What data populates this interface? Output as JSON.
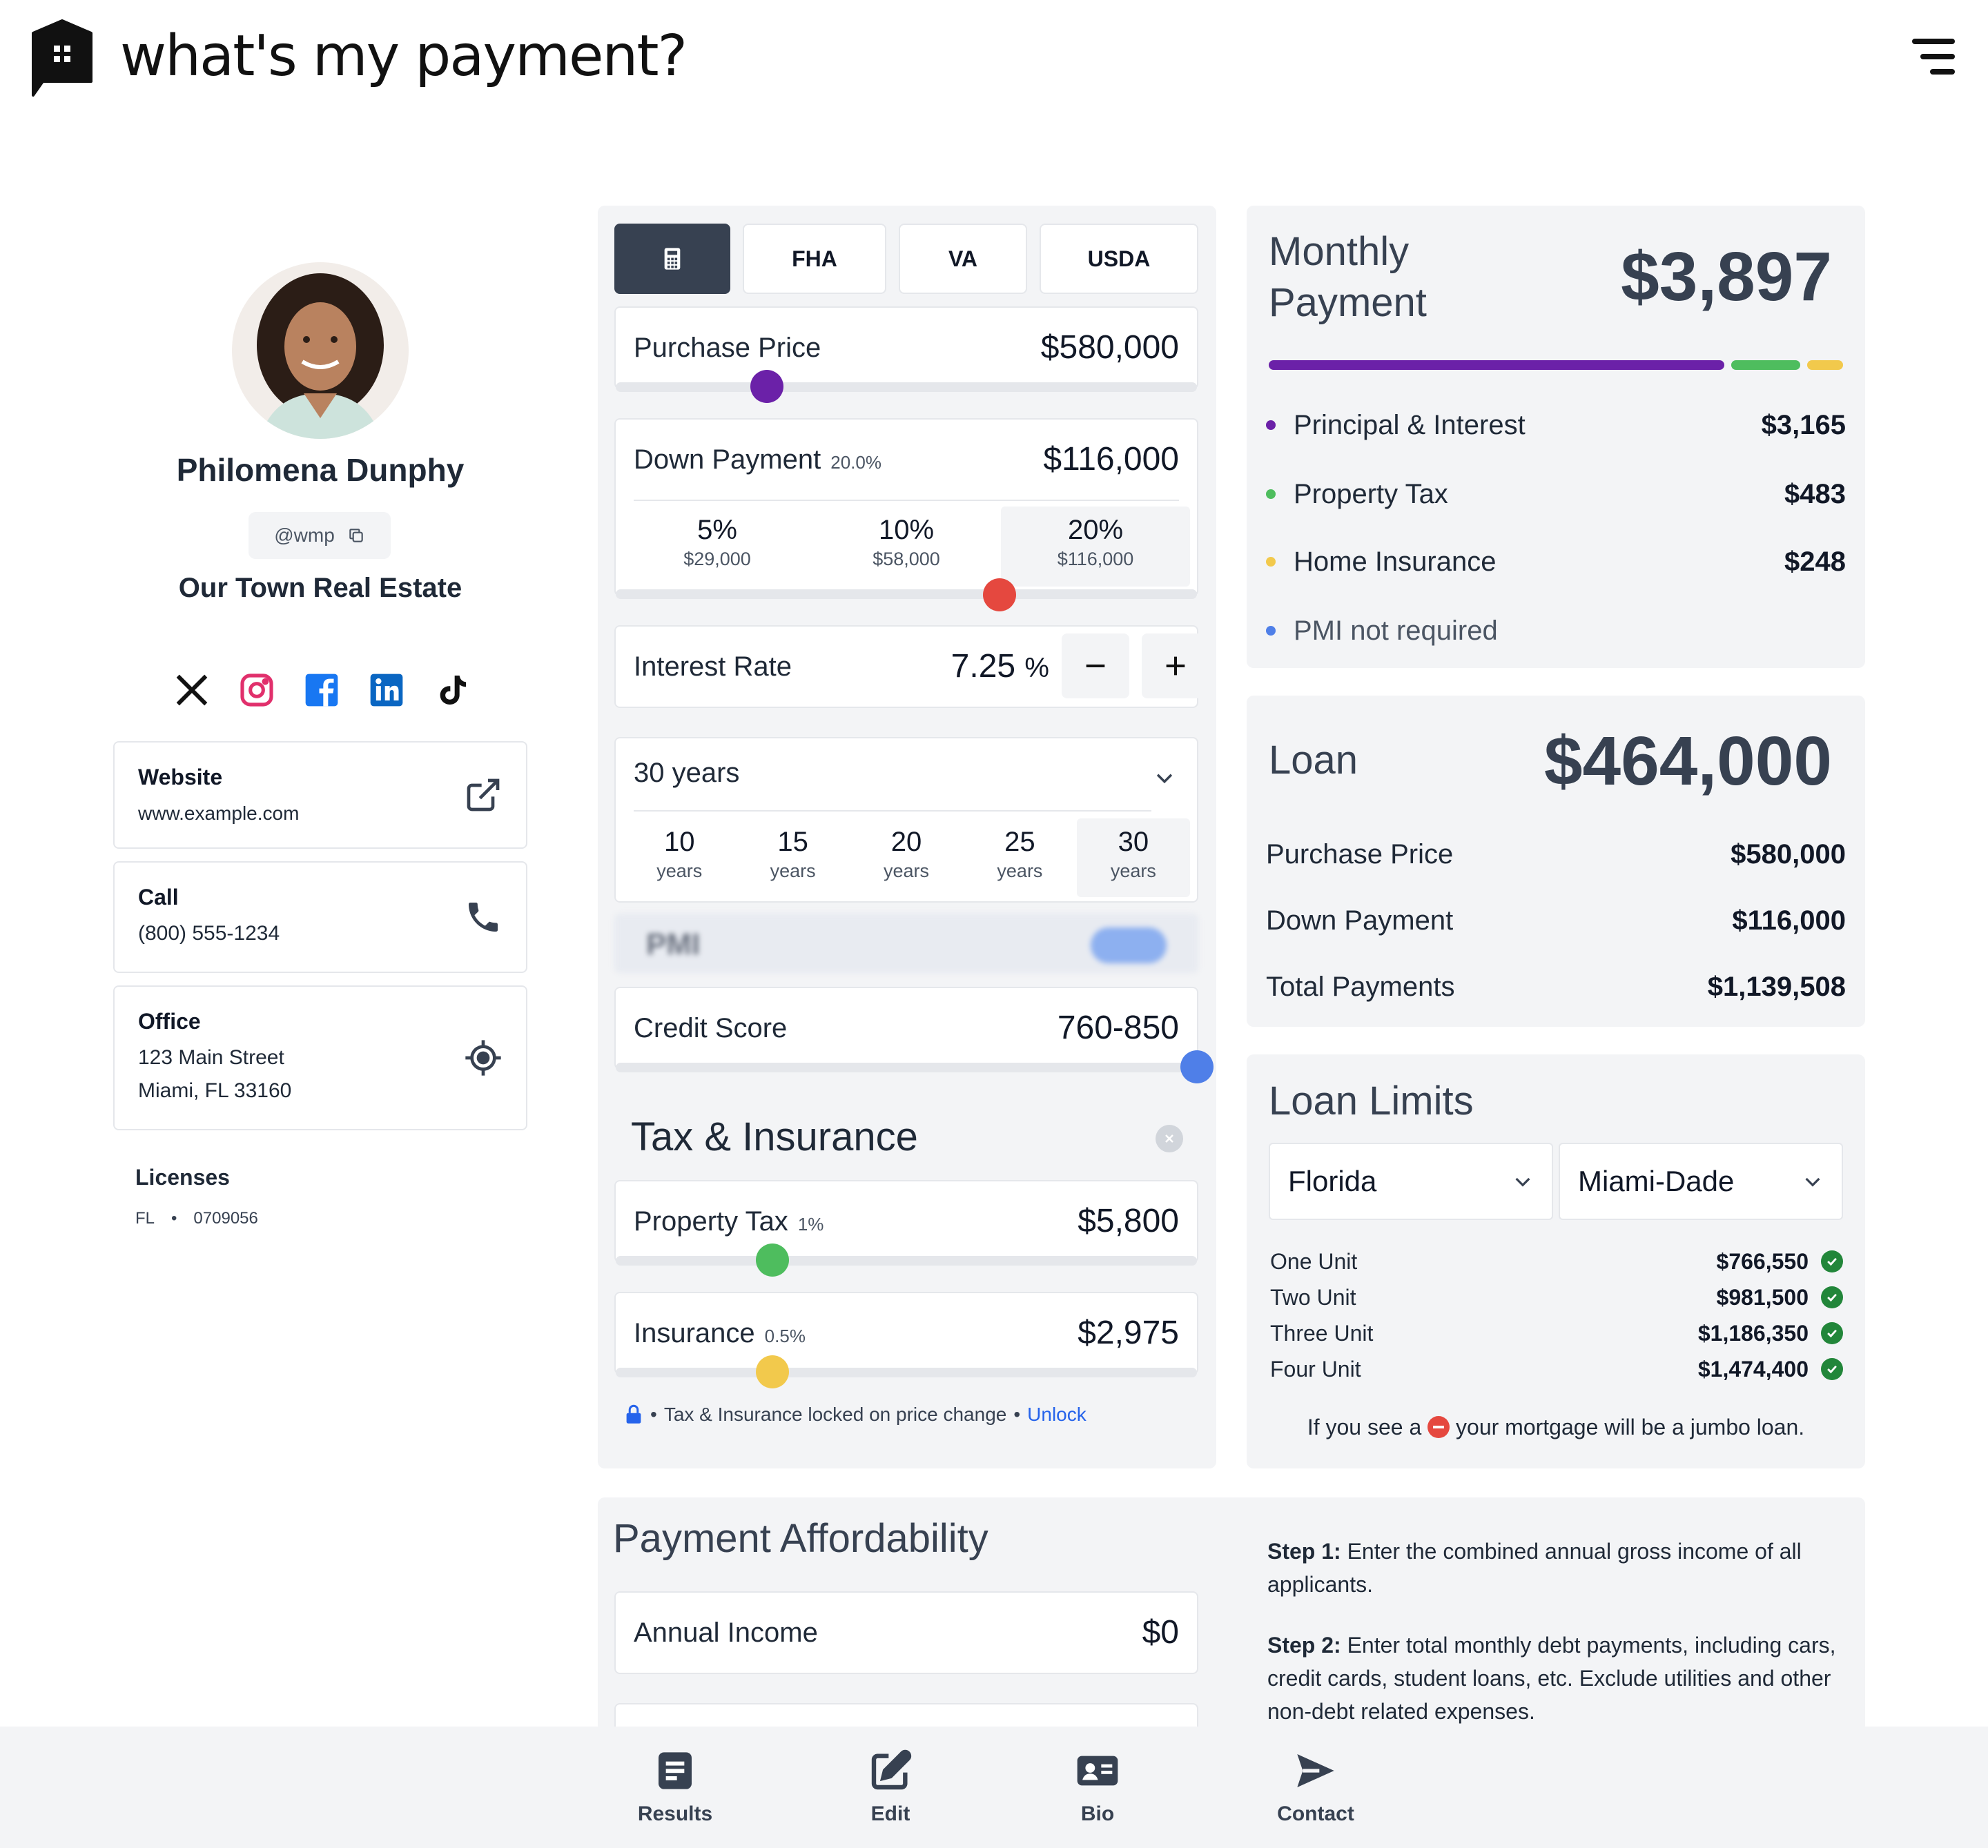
{
  "header": {
    "brand": "what's my payment?",
    "menu_icon": "hamburger-menu-icon"
  },
  "profile": {
    "name": "Philomena Dunphy",
    "handle": "@wmp",
    "brokerage": "Our Town Real Estate",
    "socials": [
      "x-icon",
      "instagram-icon",
      "facebook-icon",
      "linkedin-icon",
      "tiktok-icon"
    ],
    "website": {
      "title": "Website",
      "value": "www.example.com"
    },
    "call": {
      "title": "Call",
      "value": "(800) 555-1234"
    },
    "office": {
      "title": "Office",
      "line1": "123 Main Street",
      "line2": "Miami, FL 33160"
    },
    "licenses": {
      "title": "Licenses",
      "state": "FL",
      "number": "0709056"
    }
  },
  "calculator": {
    "tabs": [
      "FHA",
      "VA",
      "USDA"
    ],
    "purchase_price": {
      "label": "Purchase Price",
      "value": "$580,000",
      "slider_fraction": 0.26
    },
    "down_payment": {
      "label": "Down Payment",
      "percent": "20.0%",
      "value": "$116,000",
      "slider_fraction": 0.66,
      "presets": [
        {
          "pct": "5%",
          "amt": "$29,000"
        },
        {
          "pct": "10%",
          "amt": "$58,000"
        },
        {
          "pct": "20%",
          "amt": "$116,000"
        }
      ]
    },
    "interest_rate": {
      "label": "Interest Rate",
      "value": "7.25",
      "unit": "%"
    },
    "term": {
      "selected": "30 years",
      "options": [
        {
          "n": "10",
          "u": "years"
        },
        {
          "n": "15",
          "u": "years"
        },
        {
          "n": "20",
          "u": "years"
        },
        {
          "n": "25",
          "u": "years"
        },
        {
          "n": "30",
          "u": "years"
        }
      ]
    },
    "pmi_label": "PMI",
    "credit_score": {
      "label": "Credit Score",
      "value": "760-850",
      "slider_fraction": 1.0
    },
    "tax_insurance": {
      "title": "Tax & Insurance",
      "property_tax": {
        "label": "Property Tax",
        "rate": "1%",
        "value": "$5,800",
        "slider_fraction": 0.27
      },
      "insurance": {
        "label": "Insurance",
        "rate": "0.5%",
        "value": "$2,975",
        "slider_fraction": 0.27
      },
      "lock_note": "Tax & Insurance locked on price change",
      "unlock_label": "Unlock"
    }
  },
  "monthly_payment": {
    "title_line1": "Monthly",
    "title_line2": "Payment",
    "total": "$3,897",
    "items": [
      {
        "label": "Principal & Interest",
        "value": "$3,165",
        "color": "#6b21a8"
      },
      {
        "label": "Property Tax",
        "value": "$483",
        "color": "#4ebd5e"
      },
      {
        "label": "Home Insurance",
        "value": "$248",
        "color": "#f2c94c"
      },
      {
        "label": "PMI not required",
        "value": "",
        "color": "#4f7fe8"
      }
    ]
  },
  "loan": {
    "title": "Loan",
    "total": "$464,000",
    "rows": [
      {
        "label": "Purchase Price",
        "value": "$580,000"
      },
      {
        "label": "Down Payment",
        "value": "$116,000"
      },
      {
        "label": "Total Payments",
        "value": "$1,139,508"
      }
    ]
  },
  "loan_limits": {
    "title": "Loan Limits",
    "state": "Florida",
    "county": "Miami-Dade",
    "rows": [
      {
        "label": "One Unit",
        "value": "$766,550"
      },
      {
        "label": "Two Unit",
        "value": "$981,500"
      },
      {
        "label": "Three Unit",
        "value": "$1,186,350"
      },
      {
        "label": "Four Unit",
        "value": "$1,474,400"
      }
    ],
    "note_before": "If you see a",
    "note_after": "your mortgage will be a jumbo loan."
  },
  "affordability": {
    "title": "Payment Affordability",
    "annual_income": {
      "label": "Annual Income",
      "value": "$0"
    },
    "step1_label": "Step 1:",
    "step1_text": "Enter the combined annual gross income of all applicants.",
    "step2_label": "Step 2:",
    "step2_text": "Enter total monthly debt payments, including cars, credit cards, student loans, etc. Exclude utilities and other non-debt related expenses."
  },
  "bottom_nav": [
    "Results",
    "Edit",
    "Bio",
    "Contact"
  ],
  "colors": {
    "principal": "#6b21a8",
    "tax": "#4ebd5e",
    "insurance": "#f2c94c",
    "pmi": "#4f7fe8",
    "down_payment_knob": "#e5483f",
    "credit_knob": "#4f7fe8"
  }
}
